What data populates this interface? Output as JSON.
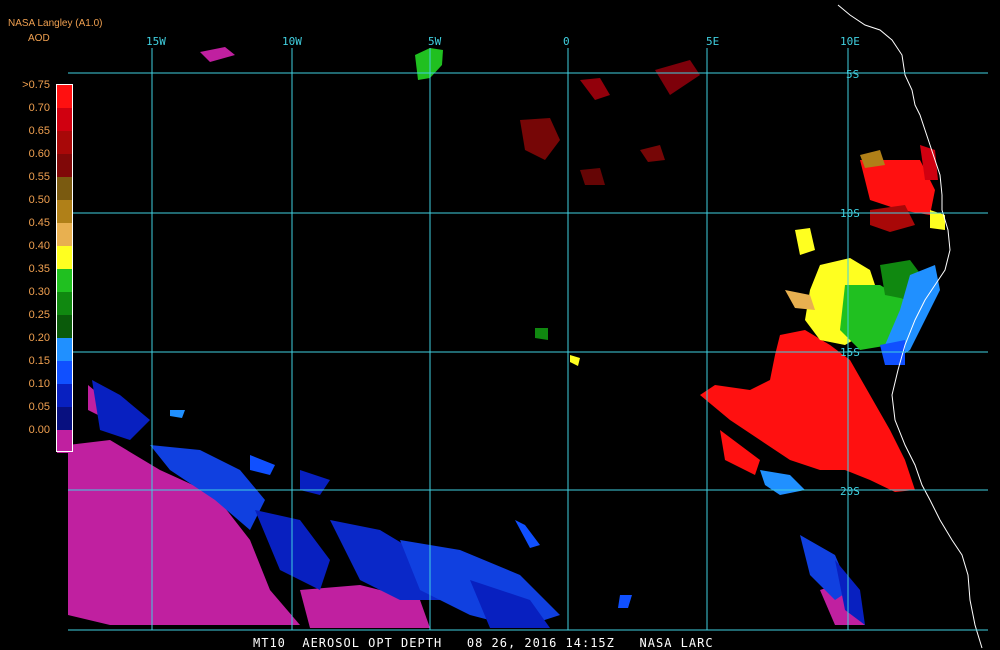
{
  "header": {
    "title": "NASA Langley (A1.0)",
    "product": "AOD"
  },
  "legend": [
    {
      "label": ">0.75",
      "color": "#ff1010"
    },
    {
      "label": "0.70",
      "color": "#d00010"
    },
    {
      "label": "0.65",
      "color": "#a80808"
    },
    {
      "label": "0.60",
      "color": "#800808"
    },
    {
      "label": "0.55",
      "color": "#7a5a10"
    },
    {
      "label": "0.50",
      "color": "#b08018"
    },
    {
      "label": "0.45",
      "color": "#e8b050"
    },
    {
      "label": "0.40",
      "color": "#ffff20"
    },
    {
      "label": "0.35",
      "color": "#20c020"
    },
    {
      "label": "0.30",
      "color": "#108810"
    },
    {
      "label": "0.25",
      "color": "#0a5a0a"
    },
    {
      "label": "0.20",
      "color": "#2090ff"
    },
    {
      "label": "0.15",
      "color": "#1050ff"
    },
    {
      "label": "0.10",
      "color": "#0820c0"
    },
    {
      "label": "0.05",
      "color": "#081080"
    },
    {
      "label": "0.00",
      "color": "#c020a0"
    }
  ],
  "grid": {
    "longitudes": [
      "15W",
      "10W",
      "5W",
      "0",
      "5E",
      "10E"
    ],
    "latitudes": [
      "5S",
      "10S",
      "15S",
      "20S"
    ],
    "line_color": "#40d0e0"
  },
  "footer": {
    "text": "MT10  AEROSOL OPT DEPTH   08 26, 2016 14:15Z   NASA LARC"
  }
}
